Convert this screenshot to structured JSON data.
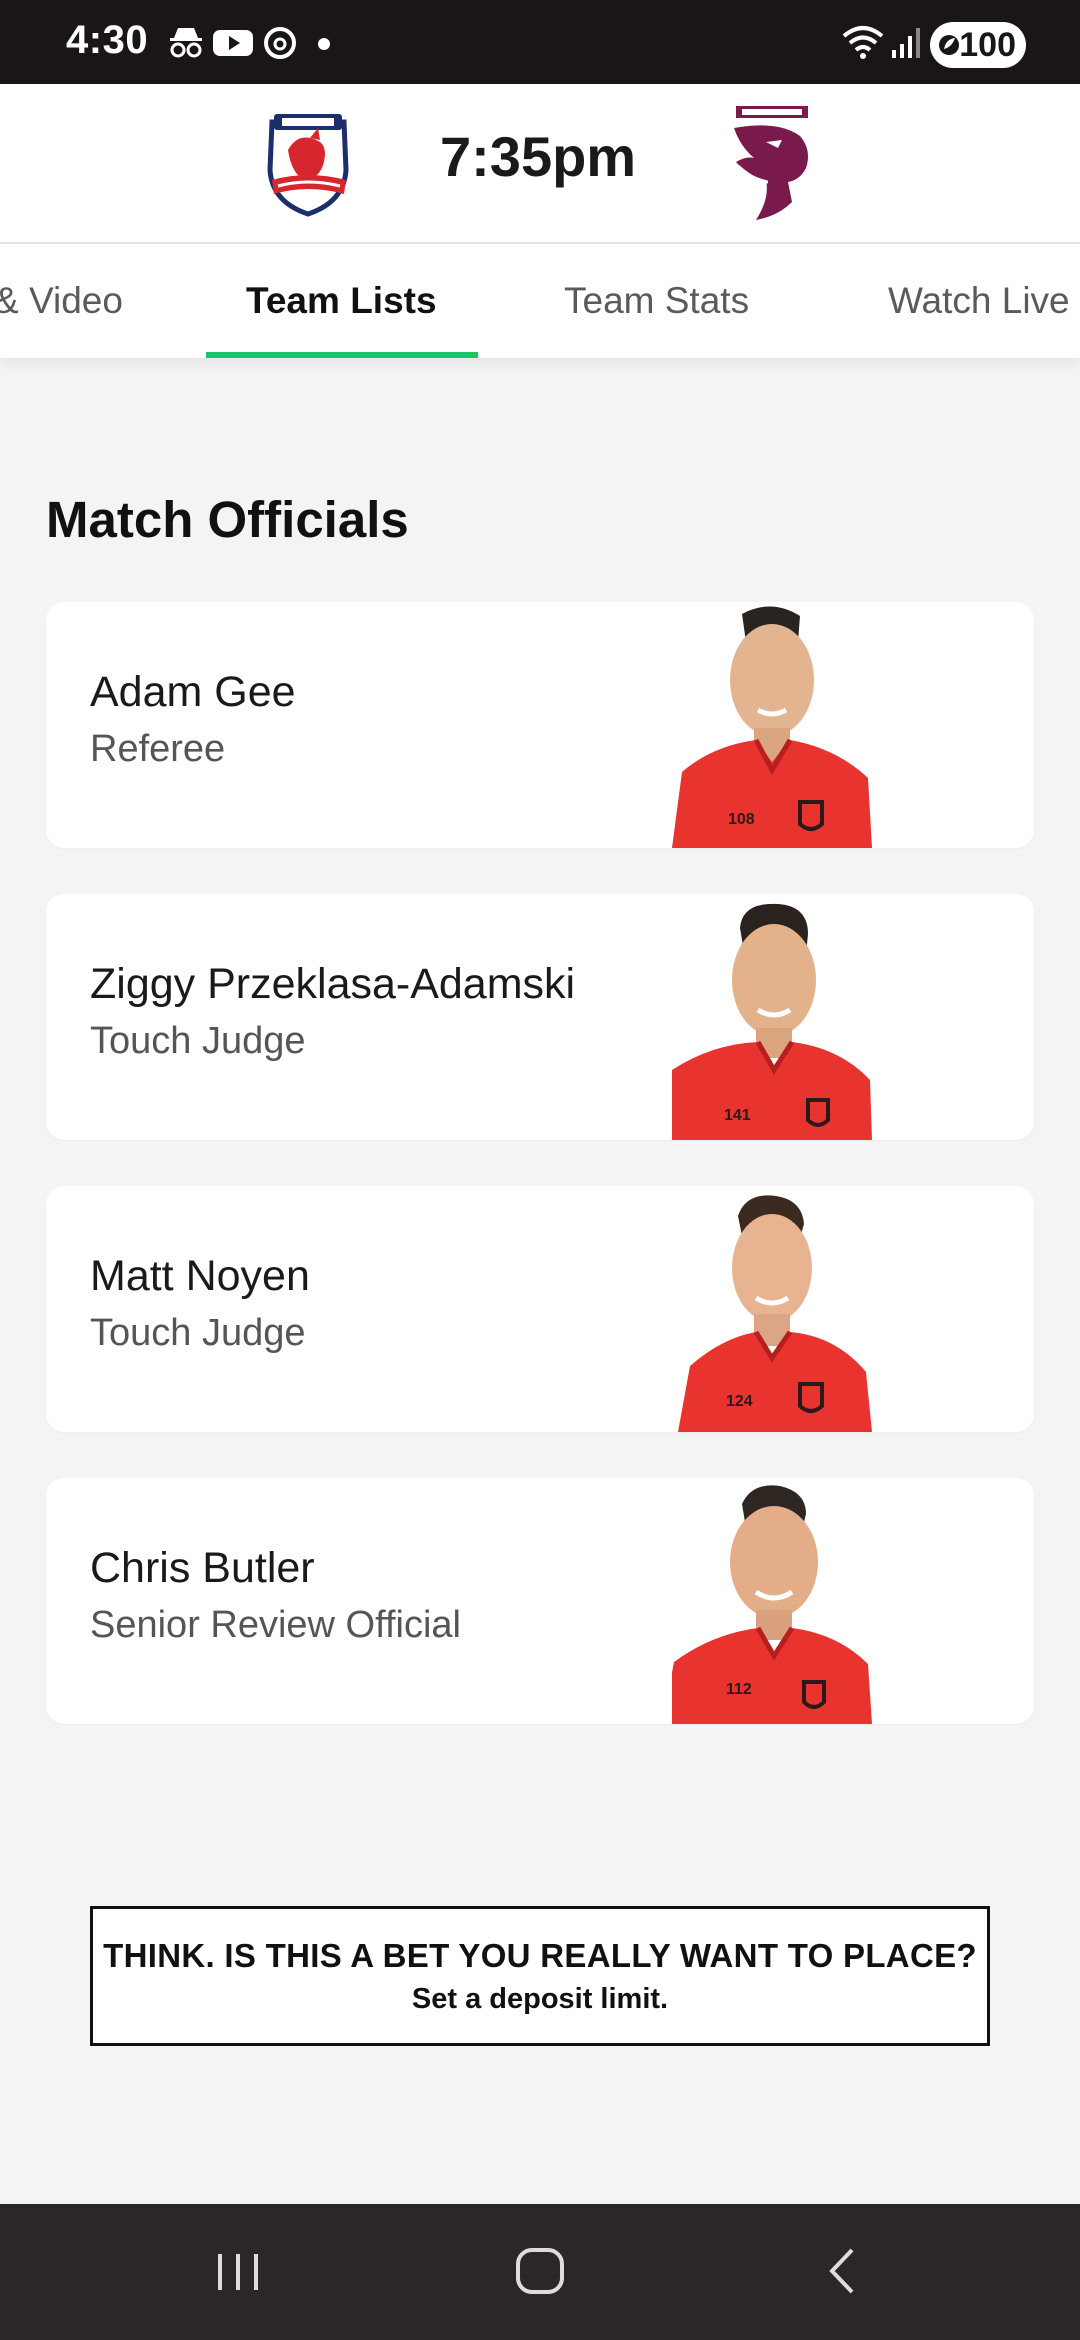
{
  "status_bar": {
    "time": "4:30",
    "icons": [
      "incognito-icon",
      "youtube-icon",
      "threads-icon",
      "notification-dot-icon",
      "wifi-icon",
      "signal-icon"
    ],
    "battery": "100"
  },
  "match": {
    "home_team": "Sydney Roosters",
    "away_team": "Brisbane Broncos",
    "kickoff": "7:35pm"
  },
  "tabs": [
    {
      "label": "& Video",
      "active": false
    },
    {
      "label": "Team Lists",
      "active": true
    },
    {
      "label": "Team Stats",
      "active": false
    },
    {
      "label": "Watch Live",
      "active": false
    }
  ],
  "section": {
    "title": "Match Officials"
  },
  "officials": [
    {
      "name": "Adam Gee",
      "role": "Referee",
      "number": "108"
    },
    {
      "name": "Ziggy Przeklasa-Adamski",
      "role": "Touch Judge",
      "number": "141"
    },
    {
      "name": "Matt Noyen",
      "role": "Touch Judge",
      "number": "124"
    },
    {
      "name": "Chris Butler",
      "role": "Senior Review Official",
      "number": "112"
    }
  ],
  "gambling_message": {
    "line1": "THINK. IS THIS A BET YOU REALLY WANT TO PLACE?",
    "line2": "Set a deposit limit."
  },
  "colors": {
    "accent_green": "#19c564",
    "jersey_red": "#e8332f",
    "roosters_red": "#d7262e",
    "roosters_navy": "#1c2f6b",
    "broncos_maroon": "#7a1a4c",
    "status_bar_bg": "#1a1519",
    "nav_bar_bg": "#2a2629"
  }
}
